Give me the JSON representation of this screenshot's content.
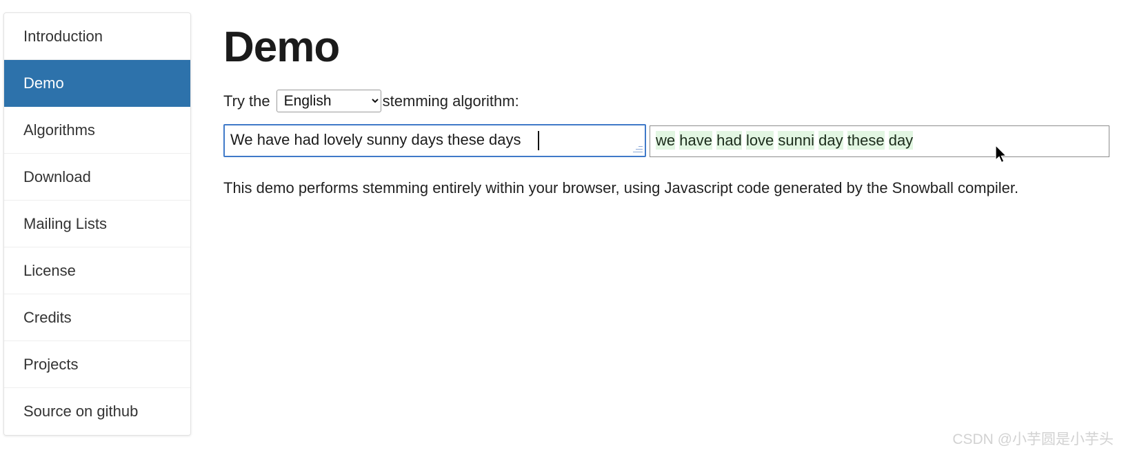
{
  "sidebar": {
    "items": [
      {
        "label": "Introduction",
        "active": false
      },
      {
        "label": "Demo",
        "active": true
      },
      {
        "label": "Algorithms",
        "active": false
      },
      {
        "label": "Download",
        "active": false
      },
      {
        "label": "Mailing Lists",
        "active": false
      },
      {
        "label": "License",
        "active": false
      },
      {
        "label": "Credits",
        "active": false
      },
      {
        "label": "Projects",
        "active": false
      },
      {
        "label": "Source on github",
        "active": false
      }
    ],
    "active_color": "#2d72ab",
    "active_text_color": "#ffffff"
  },
  "main": {
    "title": "Demo",
    "try_prefix": "Try the",
    "try_suffix": "stemming algorithm:",
    "language": {
      "selected": "English",
      "options": [
        "English"
      ]
    },
    "input": {
      "value": "We have had lovely sunny days these days",
      "placeholder": "",
      "focused": true,
      "border_color": "#3f79c8"
    },
    "output": {
      "words": [
        "we",
        "have",
        "had",
        "love",
        "sunni",
        "day",
        "these",
        "day"
      ],
      "text": "we have had love sunni day these day",
      "highlight_color": "#e2f6e2"
    },
    "note": "This demo performs stemming entirely within your browser, using Javascript code generated by the Snowball compiler."
  },
  "watermark": {
    "text": "CSDN @小芋圆是小芋头"
  }
}
